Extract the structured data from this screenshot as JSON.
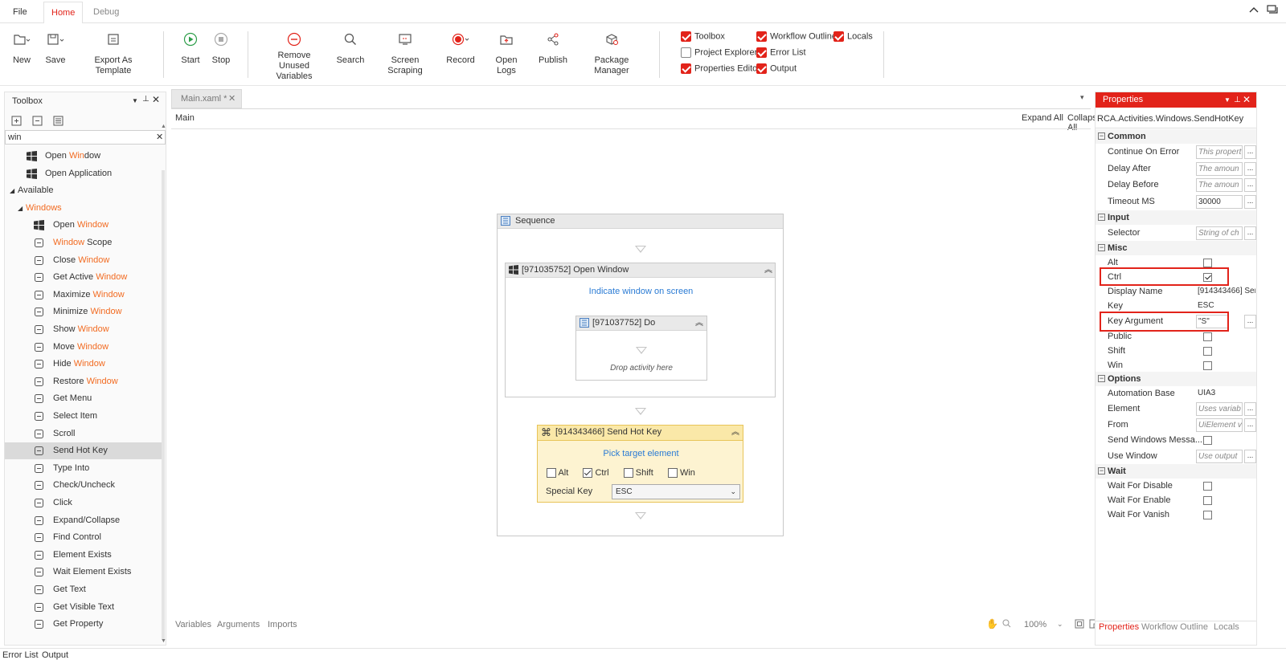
{
  "menu": {
    "file": "File",
    "home": "Home",
    "debug": "Debug"
  },
  "ribbon": {
    "new": "New",
    "save": "Save",
    "export": "Export As Template",
    "start": "Start",
    "stop": "Stop",
    "remove_unused_line1": "Remove Unused",
    "remove_unused_line2": "Variables",
    "search": "Search",
    "screen_scraping": "Screen Scraping",
    "record": "Record",
    "open_logs": "Open Logs",
    "publish": "Publish",
    "package_manager": "Package Manager",
    "toggles": {
      "toolbox": "Toolbox",
      "workflow_outline": "Workflow Outline",
      "locals": "Locals",
      "project_explorer": "Project Explorer",
      "error_list": "Error List",
      "properties_editor": "Properties Editor",
      "output": "Output"
    }
  },
  "toolbox": {
    "title": "Toolbox",
    "search_value": "win",
    "recent": [
      {
        "pre": "Open ",
        "hl": "Win",
        "post": "dow"
      },
      {
        "pre": "Open Application",
        "hl": "",
        "post": ""
      }
    ],
    "available": "Available",
    "windows_pre": "",
    "windows_hl": "Win",
    "windows_post": "dows",
    "items": [
      {
        "pre": "Open ",
        "hl": "Window",
        "post": "",
        "icon": "windows-logo-icon"
      },
      {
        "pre": "",
        "hl": "Window",
        "post": " Scope",
        "icon": "scope-icon"
      },
      {
        "pre": "Close ",
        "hl": "Window",
        "post": "",
        "icon": "close-window-icon"
      },
      {
        "pre": "Get Active ",
        "hl": "Window",
        "post": "",
        "icon": "active-window-icon"
      },
      {
        "pre": "Maximize ",
        "hl": "Window",
        "post": "",
        "icon": "maximize-icon"
      },
      {
        "pre": "Minimize ",
        "hl": "Window",
        "post": "",
        "icon": "minimize-icon"
      },
      {
        "pre": "Show ",
        "hl": "Window",
        "post": "",
        "icon": "eye-icon"
      },
      {
        "pre": "Move ",
        "hl": "Window",
        "post": "",
        "icon": "move-window-icon"
      },
      {
        "pre": "Hide ",
        "hl": "Window",
        "post": "",
        "icon": "eye-hidden-icon"
      },
      {
        "pre": "Restore ",
        "hl": "Window",
        "post": "",
        "icon": "restore-icon"
      },
      {
        "pre": "Get Menu",
        "hl": "",
        "post": "",
        "icon": "menu-icon"
      },
      {
        "pre": "Select Item",
        "hl": "",
        "post": "",
        "icon": "select-list-icon"
      },
      {
        "pre": "Scroll",
        "hl": "",
        "post": "",
        "icon": "scroll-icon"
      },
      {
        "pre": "Send Hot Key",
        "hl": "",
        "post": "",
        "icon": "command-key-icon"
      },
      {
        "pre": "Type Into",
        "hl": "",
        "post": "",
        "icon": "text-cursor-icon"
      },
      {
        "pre": "Check/Uncheck",
        "hl": "",
        "post": "",
        "icon": "checkbox-icon"
      },
      {
        "pre": "Click",
        "hl": "",
        "post": "",
        "icon": "click-icon"
      },
      {
        "pre": "Expand/Collapse",
        "hl": "",
        "post": "",
        "icon": "expand-collapse-icon"
      },
      {
        "pre": "Find Control",
        "hl": "",
        "post": "",
        "icon": "find-icon"
      },
      {
        "pre": "Element Exists",
        "hl": "",
        "post": "",
        "icon": "element-exists-icon"
      },
      {
        "pre": "Wait Element Exists",
        "hl": "",
        "post": "",
        "icon": "wait-element-icon"
      },
      {
        "pre": "Get Text",
        "hl": "",
        "post": "",
        "icon": "get-text-icon"
      },
      {
        "pre": "Get Visible Text",
        "hl": "",
        "post": "",
        "icon": "visible-text-icon"
      },
      {
        "pre": "Get Property",
        "hl": "",
        "post": "",
        "icon": "property-icon"
      }
    ]
  },
  "designer": {
    "tab": "Main.xaml *",
    "breadcrumb": "Main",
    "expand_all": "Expand All",
    "collapse_all": "Collapse All",
    "sequence": "Sequence",
    "open_window_title": "[971035752] Open Window",
    "indicate": "Indicate window on screen",
    "do_title": "[971037752] Do",
    "drop": "Drop activity here",
    "hotkey_title": "[914343466] Send Hot Key",
    "pick": "Pick target element",
    "alt": "Alt",
    "ctrl": "Ctrl",
    "shift": "Shift",
    "win": "Win",
    "special_key_label": "Special Key",
    "special_key_value": "ESC",
    "footer_variables": "Variables",
    "footer_arguments": "Arguments",
    "footer_imports": "Imports",
    "zoom": "100%"
  },
  "properties": {
    "title": "Properties",
    "type_name": "RCA.Activities.Windows.SendHotKey",
    "common": "Common",
    "continue_on_error": "Continue On Error",
    "continue_on_error_ph": "This propert",
    "delay_after": "Delay After",
    "delay_after_ph": "The amoun",
    "delay_before": "Delay Before",
    "delay_before_ph": "The amoun",
    "timeout_ms": "Timeout MS",
    "timeout_val": "30000",
    "input": "Input",
    "selector": "Selector",
    "selector_ph": "String of ch",
    "misc": "Misc",
    "alt": "Alt",
    "ctrl": "Ctrl",
    "display_name": "Display Name",
    "display_name_val": "[914343466] Sen",
    "key": "Key",
    "key_val": "ESC",
    "key_argument": "Key Argument",
    "key_argument_val": "\"S\"",
    "public": "Public",
    "shift": "Shift",
    "win": "Win",
    "options": "Options",
    "automation_base": "Automation Base",
    "automation_base_val": "UIA3",
    "element": "Element",
    "element_ph": "Uses variab",
    "from": "From",
    "from_ph": "UiElement v",
    "send_windows_messages": "Send Windows Messa...",
    "use_window": "Use Window",
    "use_window_ph": "Use output",
    "wait": "Wait",
    "wait_for_disable": "Wait For Disable",
    "wait_for_enable": "Wait For Enable",
    "wait_for_vanish": "Wait For Vanish",
    "tab_properties": "Properties",
    "tab_outline": "Workflow Outline",
    "tab_locals": "Locals"
  },
  "bottom": {
    "error_list": "Error List",
    "output": "Output"
  },
  "colors": {
    "accent": "#e2231a",
    "highlight": "#f26b21",
    "link": "#2a7bd4",
    "hotkey_bg": "#fdf3d1"
  }
}
